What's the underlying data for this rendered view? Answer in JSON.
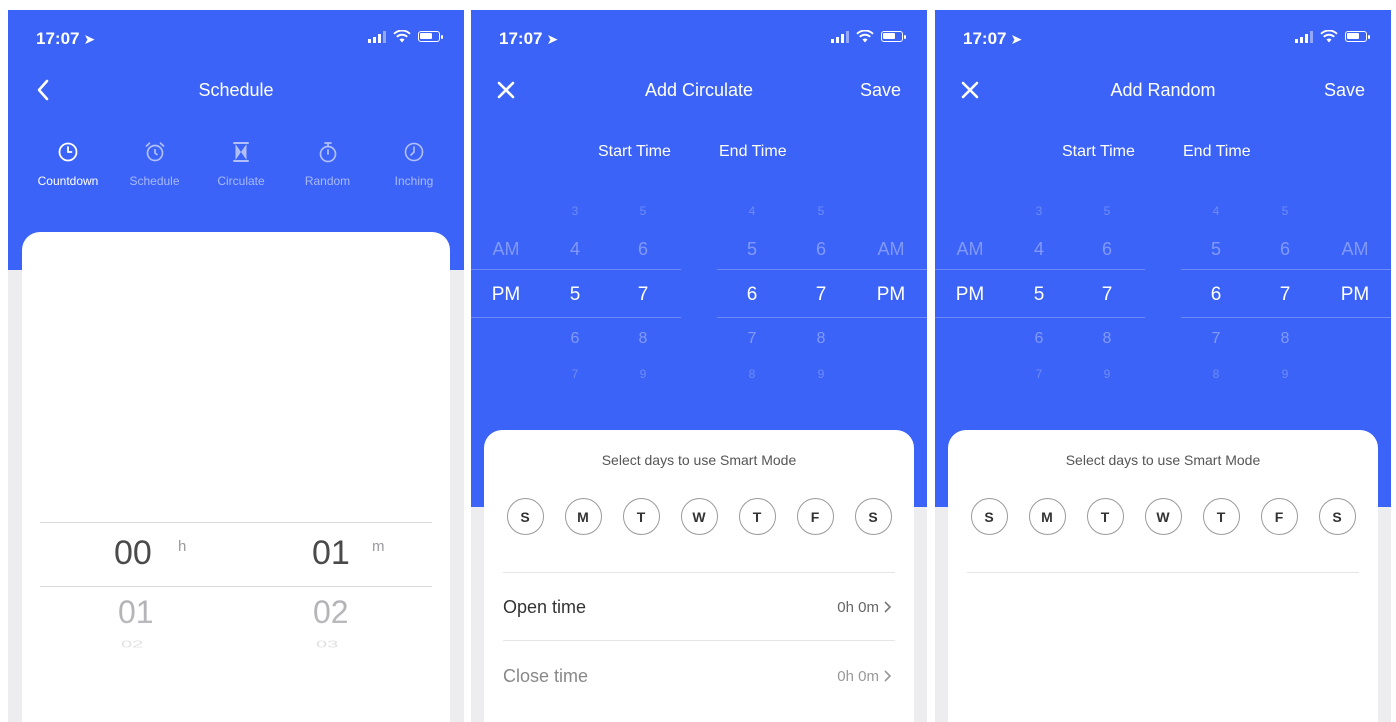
{
  "status": {
    "time": "17:07"
  },
  "screen1": {
    "title": "Schedule",
    "modes": [
      {
        "label": "Countdown",
        "icon": "clock-icon",
        "active": true
      },
      {
        "label": "Schedule",
        "icon": "alarm-clock-icon",
        "active": false
      },
      {
        "label": "Circulate",
        "icon": "hourglass-icon",
        "active": false
      },
      {
        "label": "Random",
        "icon": "stopwatch-icon",
        "active": false
      },
      {
        "label": "Inching",
        "icon": "timer-icon",
        "active": false
      }
    ],
    "picker": {
      "hours_selected": "00",
      "hours_unit": "h",
      "hours_next": "01",
      "hours_next2": "02",
      "minutes_selected": "01",
      "minutes_unit": "m",
      "minutes_next": "02",
      "minutes_next2": "03"
    }
  },
  "screen2": {
    "title": "Add Circulate",
    "save_label": "Save",
    "start_label": "Start Time",
    "end_label": "End Time",
    "wheels": {
      "ampm1": [
        "AM",
        "PM"
      ],
      "h1": [
        "3",
        "4",
        "5",
        "6",
        "7"
      ],
      "m1": [
        "5",
        "6",
        "7",
        "8",
        "9"
      ],
      "h2": [
        "4",
        "5",
        "6",
        "7",
        "8"
      ],
      "m2": [
        "5",
        "6",
        "7",
        "8",
        "9"
      ],
      "ampm2": [
        "AM",
        "PM"
      ]
    },
    "smart_mode_label": "Select days to use Smart Mode",
    "days": [
      "S",
      "M",
      "T",
      "W",
      "T",
      "F",
      "S"
    ],
    "open_time": {
      "label": "Open time",
      "value": "0h 0m"
    },
    "close_time": {
      "label": "Close time",
      "value": "0h 0m"
    }
  },
  "screen3": {
    "title": "Add Random",
    "save_label": "Save",
    "start_label": "Start Time",
    "end_label": "End Time",
    "wheels": {
      "ampm1": [
        "AM",
        "PM"
      ],
      "h1": [
        "3",
        "4",
        "5",
        "6",
        "7"
      ],
      "m1": [
        "5",
        "6",
        "7",
        "8",
        "9"
      ],
      "h2": [
        "4",
        "5",
        "6",
        "7",
        "8"
      ],
      "m2": [
        "5",
        "6",
        "7",
        "8",
        "9"
      ],
      "ampm2": [
        "AM",
        "PM"
      ]
    },
    "smart_mode_label": "Select days to use Smart Mode",
    "days": [
      "S",
      "M",
      "T",
      "W",
      "T",
      "F",
      "S"
    ]
  },
  "colors": {
    "brand": "#3c63f7",
    "background": "#ededf0",
    "card": "#ffffff"
  }
}
